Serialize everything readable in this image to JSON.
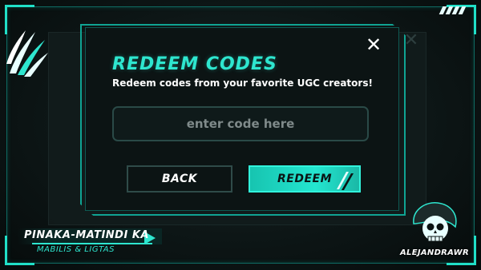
{
  "modal": {
    "title": "REDEEM CODES",
    "subtitle": "Redeem codes from your favorite UGC creators!",
    "input_placeholder": "enter code here",
    "back_label": "BACK",
    "redeem_label": "REDEEM",
    "close_icon": "close-icon"
  },
  "footer_left": {
    "title": "PINAKA-MATINDI KA",
    "subtitle": "MABILIS & LIGTAS"
  },
  "footer_right": {
    "name": "ALEJANDRAWR",
    "logo_icon": "skull-icon"
  },
  "colors": {
    "accent": "#2ee6cf",
    "frame": "#10a493",
    "background": "#0b1212",
    "button_redeem": "#24e6d0"
  }
}
